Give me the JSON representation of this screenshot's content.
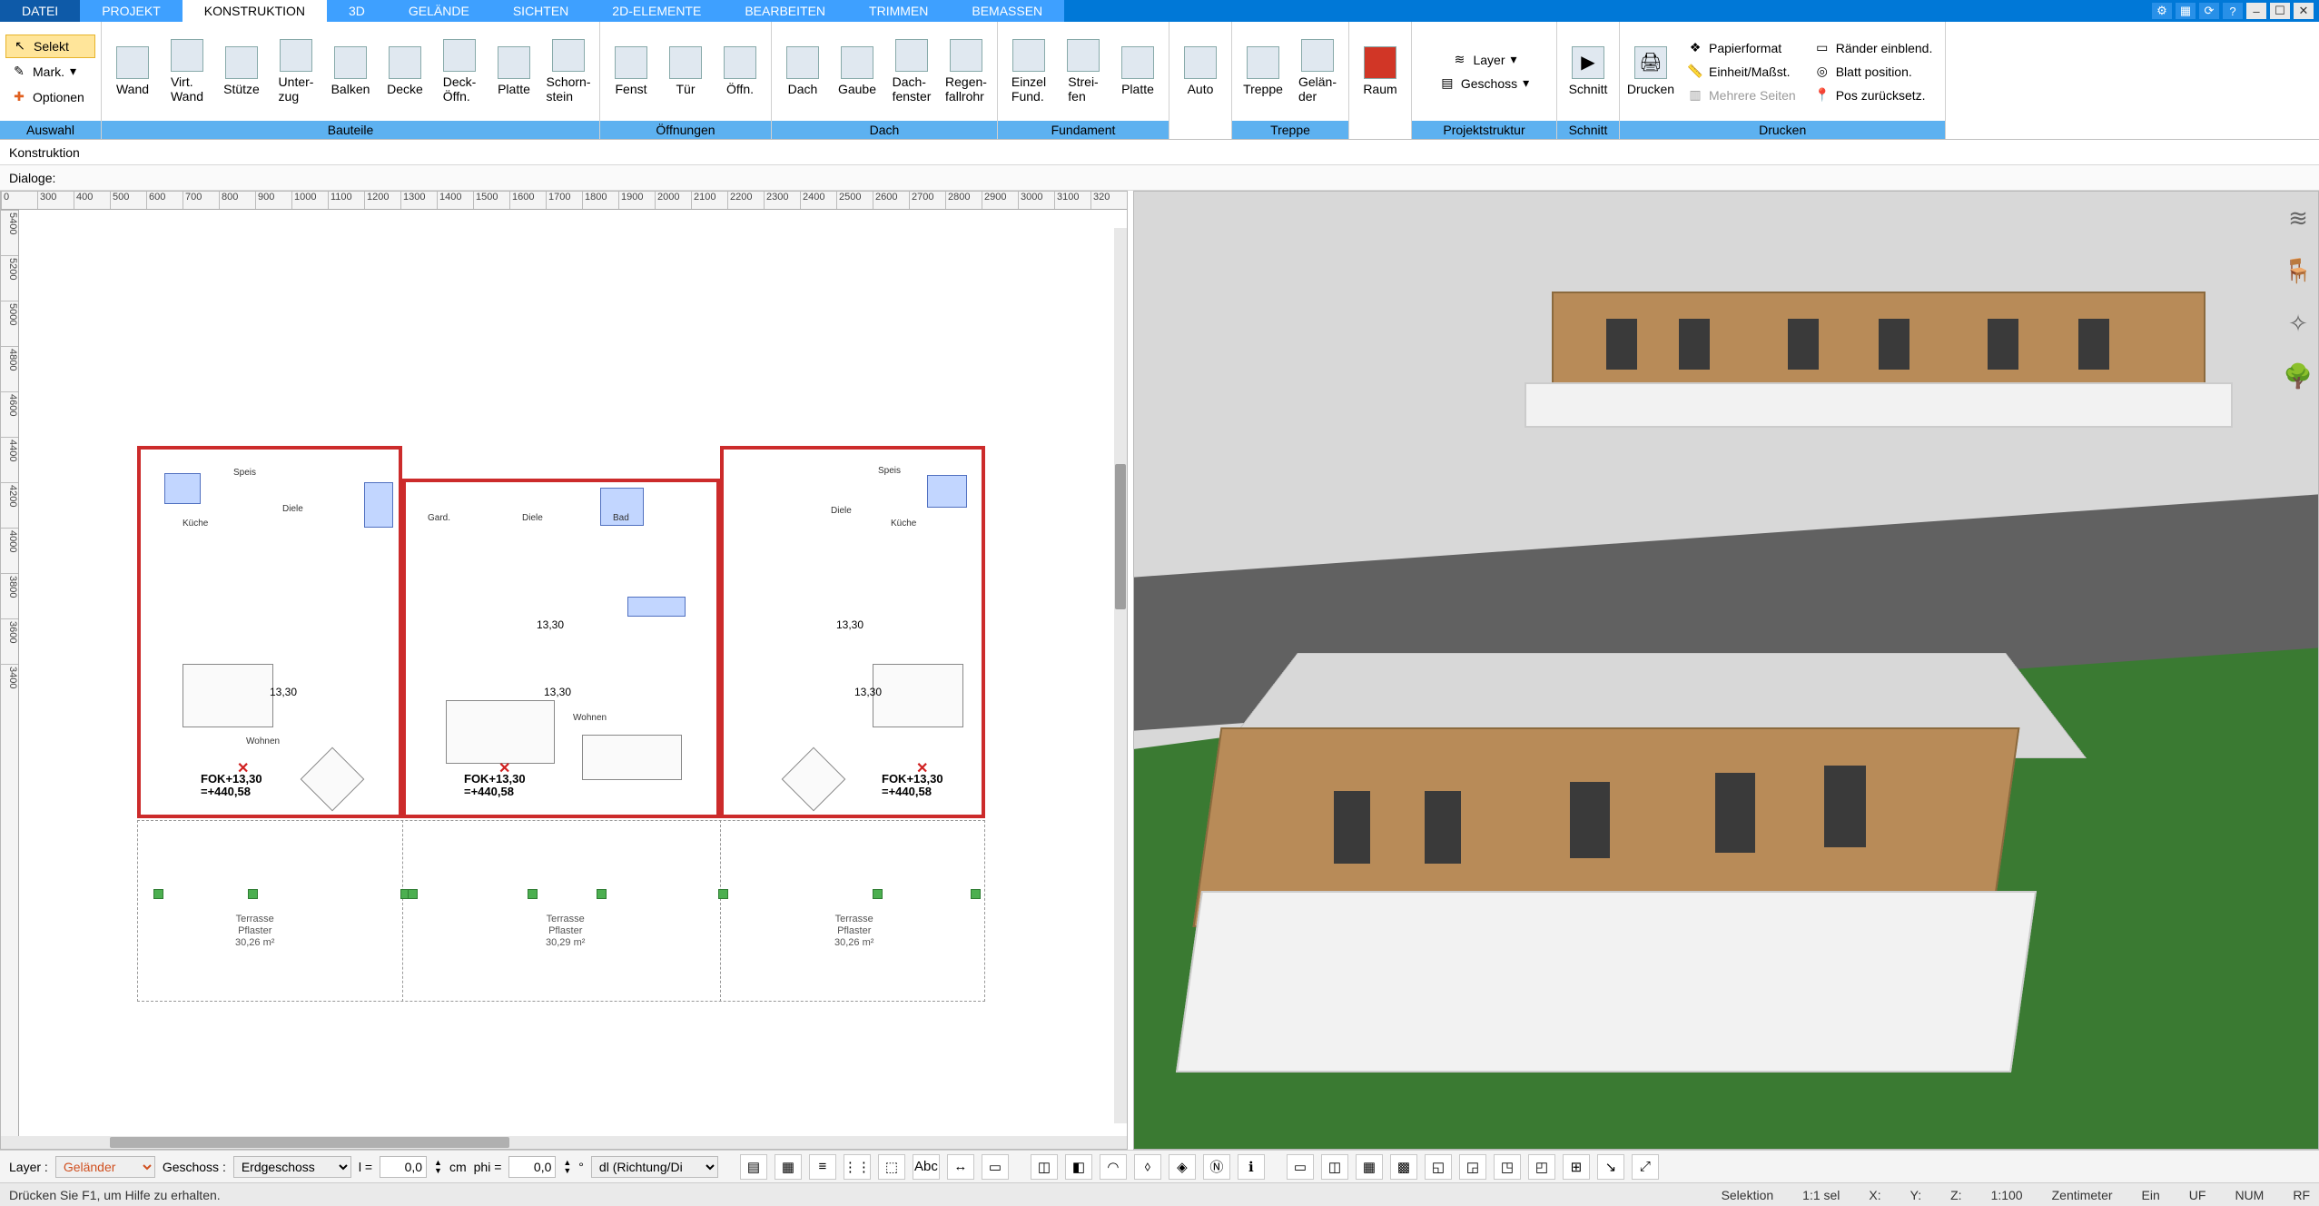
{
  "tabs": {
    "items": [
      "DATEI",
      "PROJEKT",
      "KONSTRUKTION",
      "3D",
      "GELÄNDE",
      "SICHTEN",
      "2D-ELEMENTE",
      "BEARBEITEN",
      "TRIMMEN",
      "BEMASSEN"
    ],
    "active": 2
  },
  "ribbon": {
    "auswahl": {
      "label": "Auswahl",
      "selekt": "Selekt",
      "mark": "Mark.",
      "optionen": "Optionen"
    },
    "bauteile": {
      "label": "Bauteile",
      "items": [
        "Wand",
        "Virt.\nWand",
        "Stütze",
        "Unter-\nzug",
        "Balken",
        "Decke",
        "Deck-\nÖffn.",
        "Platte",
        "Schorn-\nstein"
      ]
    },
    "oeffnungen": {
      "label": "Öffnungen",
      "items": [
        "Fenst",
        "Tür",
        "Öffn."
      ]
    },
    "dach": {
      "label": "Dach",
      "items": [
        "Dach",
        "Gaube",
        "Dach-\nfenster",
        "Regen-\nfallrohr"
      ]
    },
    "fundament": {
      "label": "Fundament",
      "items": [
        "Einzel\nFund.",
        "Strei-\nfen",
        "Platte"
      ]
    },
    "auto": {
      "label": "",
      "items": [
        "Auto"
      ]
    },
    "treppe": {
      "label": "Treppe",
      "items": [
        "Treppe",
        "Gelän-\nder"
      ]
    },
    "raum": {
      "label": "",
      "items": [
        "Raum"
      ]
    },
    "projektstruktur": {
      "label": "Projektstruktur",
      "layer": "Layer",
      "geschoss": "Geschoss"
    },
    "schnitt": {
      "label": "Schnitt",
      "items": [
        "Schnitt"
      ]
    },
    "drucken": {
      "label": "Drucken",
      "items": [
        "Drucken"
      ],
      "papierformat": "Papierformat",
      "einheit": "Einheit/Maßst.",
      "mehrere": "Mehrere Seiten",
      "raender": "Ränder einblend.",
      "blatt": "Blatt position.",
      "pos": "Pos zurücksetz."
    }
  },
  "subbar1": {
    "label": "Konstruktion"
  },
  "subbar2": {
    "label": "Dialoge:"
  },
  "ruler_top": [
    "0",
    "300",
    "400",
    "500",
    "600",
    "700",
    "800",
    "900",
    "1000",
    "1100",
    "1200",
    "1300",
    "1400",
    "1500",
    "1600",
    "1700",
    "1800",
    "1900",
    "2000",
    "2100",
    "2200",
    "2300",
    "2400",
    "2500",
    "2600",
    "2700",
    "2800",
    "2900",
    "3000",
    "3100",
    "320"
  ],
  "ruler_left": [
    "5400",
    "5200",
    "5000",
    "4800",
    "4600",
    "4400",
    "4200",
    "4000",
    "3800",
    "3600",
    "3400"
  ],
  "plan": {
    "fok_line1": "FOK+13,30",
    "fok_line2": "=+440,58",
    "dim": "13,30",
    "terrasse": "Terrasse",
    "pflaster": "Pflaster",
    "areas": [
      "30,26 m²",
      "30,29 m²",
      "30,26 m²"
    ],
    "rooms": {
      "wohnen": "Wohnen",
      "diele": "Diele",
      "speis": "Speis",
      "gard": "Gard.",
      "kueche": "Küche",
      "bad": "Bad"
    }
  },
  "bottom": {
    "layer_label": "Layer :",
    "layer_value": "Geländer",
    "geschoss_label": "Geschoss :",
    "geschoss_value": "Erdgeschoss",
    "l_label": "l =",
    "l_value": "0,0",
    "phi_label": "phi =",
    "phi_value": "0,0",
    "unit": "cm",
    "deg": "°",
    "dl": "dl (Richtung/Di"
  },
  "status": {
    "help": "Drücken Sie F1, um Hilfe zu erhalten.",
    "selektion": "Selektion",
    "sel": "1:1 sel",
    "x": "X:",
    "y": "Y:",
    "z": "Z:",
    "scale": "1:100",
    "unit": "Zentimeter",
    "ein": "Ein",
    "uf": "UF",
    "num": "NUM",
    "rf": "RF"
  }
}
